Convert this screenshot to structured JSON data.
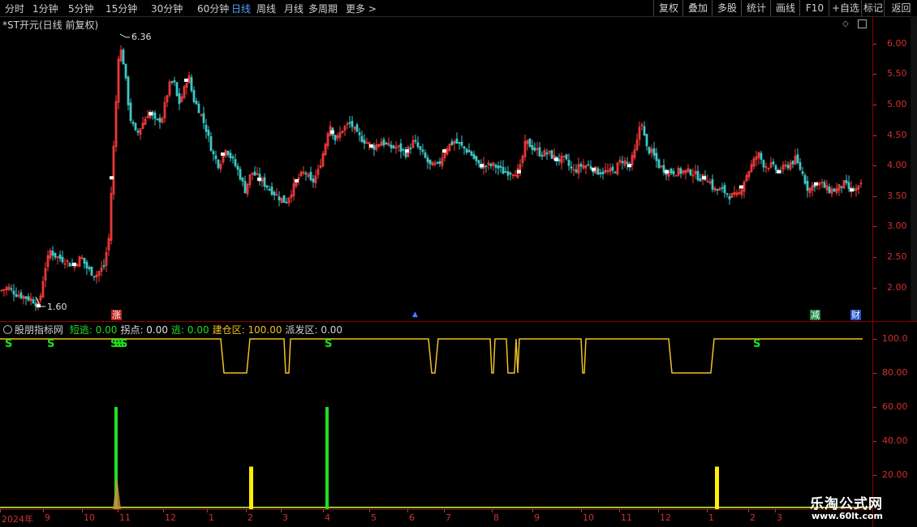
{
  "toolbar": {
    "periods": [
      "分时",
      "1分钟",
      "5分钟",
      "15分钟",
      "30分钟",
      "60分钟",
      "日线",
      "周线",
      "月线",
      "多周期",
      "更多 >"
    ],
    "active_period": "日线",
    "right_buttons": [
      "复权",
      "叠加",
      "多股",
      "统计",
      "画线",
      "F10",
      "+自选",
      "标记",
      "返回"
    ]
  },
  "main_chart": {
    "title": "*ST开元(日线 前复权)",
    "high_label": "6.36",
    "low_label": "1.60",
    "y_ticks": [
      "6.00",
      "5.50",
      "5.00",
      "4.50",
      "4.00",
      "3.50",
      "3.00",
      "2.50",
      "2.00"
    ],
    "markers": [
      "涨",
      "减",
      "财"
    ]
  },
  "indicator": {
    "name": "股朋指标网",
    "fields": [
      {
        "label": "短逃:",
        "value": "0.00",
        "color": "#22dd22"
      },
      {
        "label": "拐点:",
        "value": "0.00",
        "color": "#e0e0e0"
      },
      {
        "label": "逃:",
        "value": "0.00",
        "color": "#22dd22"
      },
      {
        "label": "建仓区:",
        "value": "100.00",
        "color": "#f0c020"
      },
      {
        "label": "派发区:",
        "value": "0.00",
        "color": "#d0d0d0"
      }
    ],
    "y_ticks": [
      "100.0",
      "80.00",
      "60.00",
      "40.00",
      "20.00"
    ],
    "signal_glyph": "S"
  },
  "date_axis": [
    "2024年",
    "9",
    "10",
    "11",
    "12",
    "1",
    "2",
    "3",
    "4",
    "5",
    "6",
    "7",
    "8",
    "9",
    "10",
    "11",
    "12",
    "1",
    "2",
    "3"
  ],
  "watermark": {
    "line1": "乐淘公式网",
    "line2": "www.60lt.com"
  },
  "colors": {
    "up": "#ff3c3c",
    "down": "#3cc8c8",
    "grid": "#8b0000",
    "axis_text": "#d23030",
    "line": "#f0c020",
    "green": "#22dd22",
    "yellow": "#ffee00"
  },
  "chart_data": {
    "type": "candlestick",
    "price_range": [
      1.45,
      6.45
    ],
    "indicator_range": [
      0,
      100
    ],
    "close_path": [
      [
        0,
        1.95
      ],
      [
        10,
        2.0
      ],
      [
        20,
        1.9
      ],
      [
        30,
        1.85
      ],
      [
        40,
        1.8
      ],
      [
        48,
        1.7
      ],
      [
        55,
        2.3
      ],
      [
        62,
        2.6
      ],
      [
        70,
        2.5
      ],
      [
        80,
        2.45
      ],
      [
        90,
        2.35
      ],
      [
        100,
        2.5
      ],
      [
        108,
        2.3
      ],
      [
        118,
        2.2
      ],
      [
        128,
        2.35
      ],
      [
        134,
        2.8
      ],
      [
        138,
        3.8
      ],
      [
        142,
        4.8
      ],
      [
        146,
        5.8
      ],
      [
        150,
        5.9
      ],
      [
        154,
        5.5
      ],
      [
        160,
        4.8
      ],
      [
        168,
        4.5
      ],
      [
        176,
        4.7
      ],
      [
        184,
        4.9
      ],
      [
        192,
        4.7
      ],
      [
        200,
        4.8
      ],
      [
        208,
        5.3
      ],
      [
        214,
        5.4
      ],
      [
        220,
        5.0
      ],
      [
        226,
        5.2
      ],
      [
        232,
        5.5
      ],
      [
        238,
        5.1
      ],
      [
        246,
        4.9
      ],
      [
        254,
        4.6
      ],
      [
        262,
        4.2
      ],
      [
        270,
        4.0
      ],
      [
        278,
        4.3
      ],
      [
        286,
        4.1
      ],
      [
        294,
        3.9
      ],
      [
        302,
        3.6
      ],
      [
        310,
        3.9
      ],
      [
        318,
        3.8
      ],
      [
        326,
        3.7
      ],
      [
        334,
        3.6
      ],
      [
        342,
        3.5
      ],
      [
        352,
        3.4
      ],
      [
        360,
        3.6
      ],
      [
        368,
        3.8
      ],
      [
        376,
        3.9
      ],
      [
        384,
        3.7
      ],
      [
        392,
        3.9
      ],
      [
        400,
        4.3
      ],
      [
        406,
        4.7
      ],
      [
        414,
        4.4
      ],
      [
        422,
        4.6
      ],
      [
        432,
        4.7
      ],
      [
        440,
        4.5
      ],
      [
        450,
        4.4
      ],
      [
        460,
        4.3
      ],
      [
        470,
        4.4
      ],
      [
        480,
        4.3
      ],
      [
        490,
        4.3
      ],
      [
        500,
        4.2
      ],
      [
        510,
        4.4
      ],
      [
        520,
        4.2
      ],
      [
        530,
        4.0
      ],
      [
        540,
        4.0
      ],
      [
        550,
        4.3
      ],
      [
        560,
        4.4
      ],
      [
        570,
        4.3
      ],
      [
        580,
        4.2
      ],
      [
        590,
        4.0
      ],
      [
        600,
        4.0
      ],
      [
        610,
        4.0
      ],
      [
        620,
        3.9
      ],
      [
        630,
        3.9
      ],
      [
        640,
        3.9
      ],
      [
        648,
        4.4
      ],
      [
        656,
        4.3
      ],
      [
        666,
        4.2
      ],
      [
        676,
        4.2
      ],
      [
        686,
        4.1
      ],
      [
        696,
        4.1
      ],
      [
        706,
        3.9
      ],
      [
        716,
        4.0
      ],
      [
        726,
        4.0
      ],
      [
        736,
        3.9
      ],
      [
        746,
        3.9
      ],
      [
        756,
        3.9
      ],
      [
        766,
        4.1
      ],
      [
        776,
        4.0
      ],
      [
        784,
        4.3
      ],
      [
        790,
        4.8
      ],
      [
        796,
        4.3
      ],
      [
        804,
        4.2
      ],
      [
        812,
        4.0
      ],
      [
        822,
        3.9
      ],
      [
        832,
        3.9
      ],
      [
        842,
        3.9
      ],
      [
        852,
        3.9
      ],
      [
        862,
        3.8
      ],
      [
        872,
        3.8
      ],
      [
        880,
        3.6
      ],
      [
        890,
        3.6
      ],
      [
        900,
        3.5
      ],
      [
        910,
        3.5
      ],
      [
        918,
        3.8
      ],
      [
        926,
        4.0
      ],
      [
        934,
        4.2
      ],
      [
        942,
        4.0
      ],
      [
        950,
        4.0
      ],
      [
        960,
        3.9
      ],
      [
        970,
        4.0
      ],
      [
        980,
        4.1
      ],
      [
        988,
        3.9
      ],
      [
        996,
        3.6
      ],
      [
        1004,
        3.7
      ],
      [
        1012,
        3.7
      ],
      [
        1020,
        3.6
      ],
      [
        1030,
        3.6
      ],
      [
        1040,
        3.7
      ],
      [
        1048,
        3.6
      ],
      [
        1056,
        3.6
      ],
      [
        1064,
        3.7
      ]
    ],
    "line_path": [
      [
        0,
        100
      ],
      [
        272,
        100
      ],
      [
        276,
        80
      ],
      [
        290,
        80
      ],
      [
        304,
        80
      ],
      [
        308,
        100
      ],
      [
        350,
        100
      ],
      [
        352,
        80
      ],
      [
        356,
        80
      ],
      [
        358,
        100
      ],
      [
        528,
        100
      ],
      [
        532,
        80
      ],
      [
        536,
        80
      ],
      [
        540,
        100
      ],
      [
        604,
        100
      ],
      [
        606,
        80
      ],
      [
        608,
        80
      ],
      [
        610,
        100
      ],
      [
        624,
        100
      ],
      [
        626,
        80
      ],
      [
        634,
        80
      ],
      [
        636,
        100
      ],
      [
        638,
        80
      ],
      [
        640,
        100
      ],
      [
        716,
        100
      ],
      [
        718,
        80
      ],
      [
        720,
        80
      ],
      [
        722,
        100
      ],
      [
        824,
        100
      ],
      [
        828,
        80
      ],
      [
        876,
        80
      ],
      [
        880,
        100
      ],
      [
        1063,
        100
      ]
    ],
    "green_bars": [
      {
        "x": 143,
        "value": 60
      },
      {
        "x": 403,
        "value": 60
      }
    ],
    "yellow_bars": [
      {
        "x": 310,
        "value": 25
      },
      {
        "x": 884,
        "value": 25
      }
    ],
    "orange_spike": {
      "x": 144,
      "value": 20
    },
    "signals_x": [
      8,
      60,
      138,
      142,
      146,
      150,
      402,
      930
    ]
  }
}
